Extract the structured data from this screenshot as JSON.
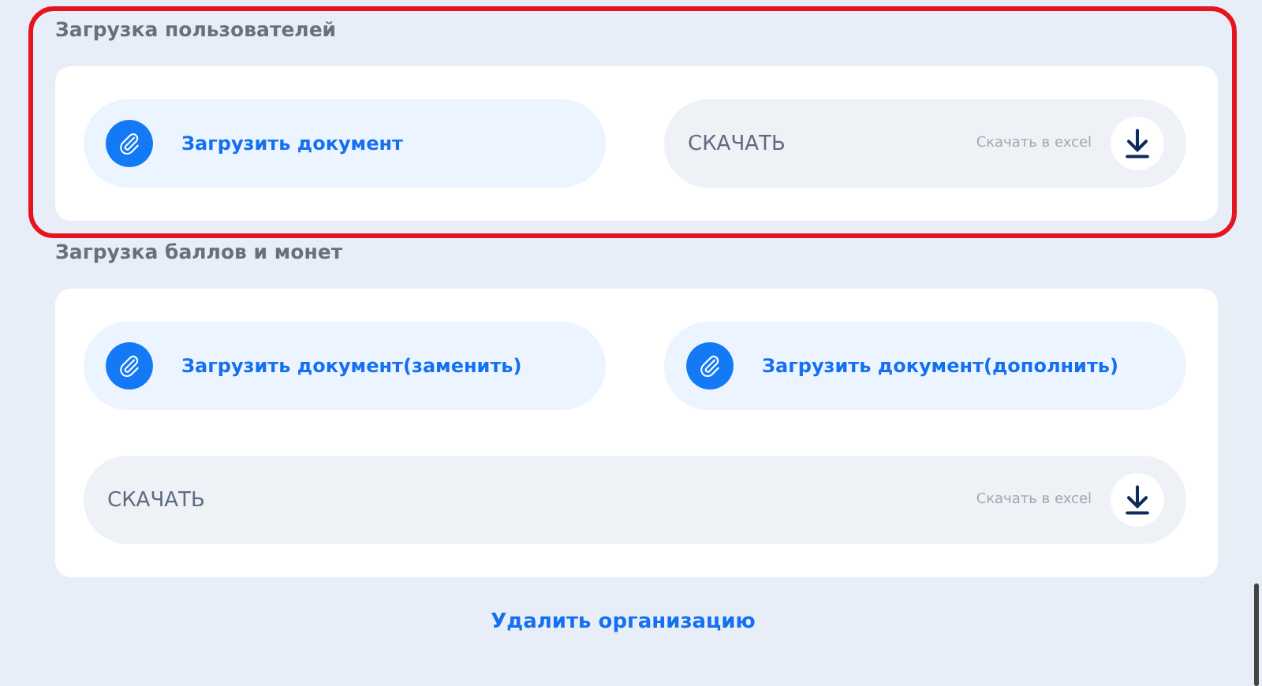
{
  "sections": [
    {
      "title": "Загрузка пользователей",
      "highlighted": true,
      "rows": [
        [
          {
            "kind": "upload",
            "label": "Загрузить документ"
          },
          {
            "kind": "download",
            "label": "СКАЧАТЬ",
            "hint": "Скачать в excel"
          }
        ]
      ]
    },
    {
      "title": "Загрузка баллов и монет",
      "highlighted": false,
      "rows": [
        [
          {
            "kind": "upload",
            "label": "Загрузить документ(заменить)"
          },
          {
            "kind": "upload",
            "label": "Загрузить документ(дополнить)"
          }
        ],
        [
          {
            "kind": "download",
            "label": "СКАЧАТЬ",
            "hint": "Скачать в excel"
          }
        ]
      ]
    }
  ],
  "delete_link": "Удалить организацию"
}
